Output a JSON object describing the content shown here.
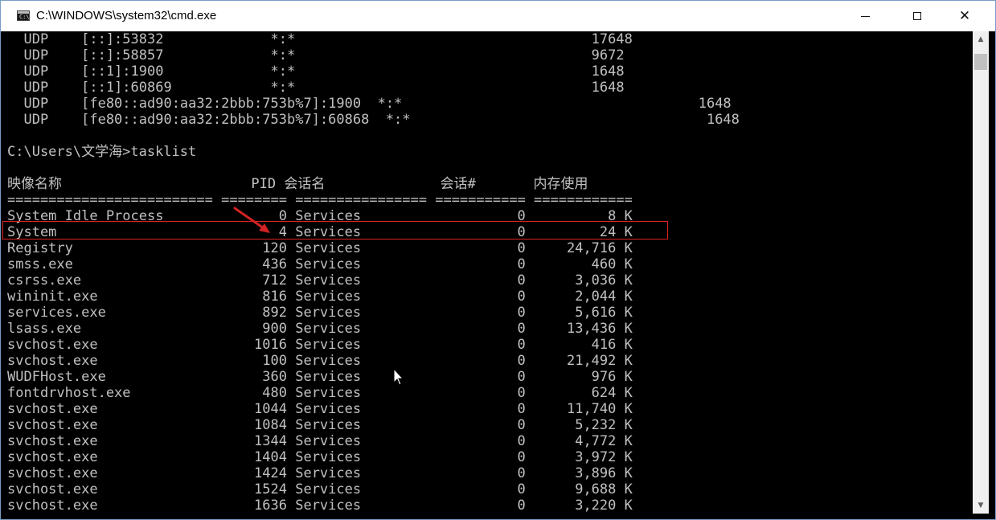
{
  "window": {
    "title": "C:\\WINDOWS\\system32\\cmd.exe",
    "icon": "console-icon",
    "icon_prompt": "C:\\",
    "controls": [
      "minimize-icon",
      "maximize-icon",
      "close-icon"
    ],
    "close_glyph": "✕",
    "scroll_up_glyph": "▲",
    "scroll_down_glyph": "▼"
  },
  "console": {
    "lines": [
      "  UDP    [::]:53832             *:*                                    17648",
      "  UDP    [::]:58857             *:*                                    9672",
      "  UDP    [::1]:1900             *:*                                    1648",
      "  UDP    [::1]:60869            *:*                                    1648",
      "  UDP    [fe80::ad90:aa32:2bbb:753b%7]:1900  *:*                                    1648",
      "  UDP    [fe80::ad90:aa32:2bbb:753b%7]:60868  *:*                                    1648",
      "",
      "C:\\Users\\文学海>tasklist",
      "",
      "映像名称                       PID 会话名              会话#       内存使用",
      "========================= ======== ================ =========== ============",
      "System Idle Process              0 Services                   0          8 K",
      "System                           4 Services                   0         24 K",
      "Registry                       120 Services                   0     24,716 K",
      "smss.exe                       436 Services                   0        460 K",
      "csrss.exe                      712 Services                   0      3,036 K",
      "wininit.exe                    816 Services                   0      2,044 K",
      "services.exe                   892 Services                   0      5,616 K",
      "lsass.exe                      900 Services                   0     13,436 K",
      "svchost.exe                   1016 Services                   0        416 K",
      "svchost.exe                    100 Services                   0     21,492 K",
      "WUDFHost.exe                   360 Services                   0        976 K",
      "fontdrvhost.exe                480 Services                   0        624 K",
      "svchost.exe                   1044 Services                   0     11,740 K",
      "svchost.exe                   1084 Services                   0      5,232 K",
      "svchost.exe                   1344 Services                   0      4,772 K",
      "svchost.exe                   1404 Services                   0      3,972 K",
      "svchost.exe                   1424 Services                   0      3,896 K",
      "svchost.exe                   1524 Services                   0      9,688 K",
      "svchost.exe                   1636 Services                   0      3,220 K"
    ],
    "text_color": "#c0c0c0",
    "background": "#000000"
  },
  "annotations": {
    "highlight_color": "#d22222",
    "highlighted_process": "System"
  }
}
